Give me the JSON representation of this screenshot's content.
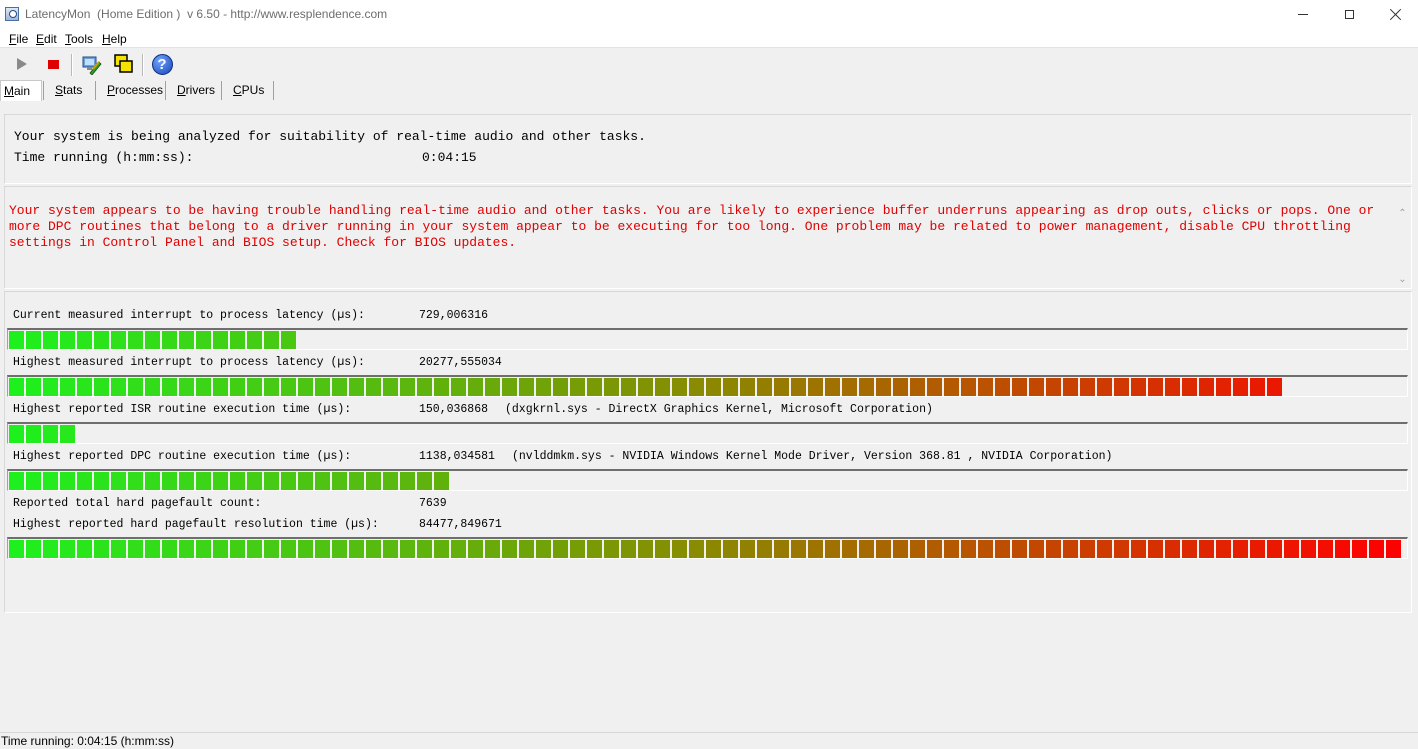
{
  "window": {
    "title": "LatencyMon  (Home Edition )  v 6.50 - http://www.resplendence.com"
  },
  "menu": [
    {
      "key": "F",
      "rest": "ile"
    },
    {
      "key": "E",
      "rest": "dit"
    },
    {
      "key": "T",
      "rest": "ools"
    },
    {
      "key": "H",
      "rest": "elp"
    }
  ],
  "toolbar": {
    "icons": [
      "play-icon",
      "stop-icon",
      "cleanup-icon",
      "windows-icon",
      "help-icon"
    ],
    "help_glyph": "?"
  },
  "tabs": [
    {
      "key": "M",
      "rest": "ain",
      "active": true
    },
    {
      "key": "S",
      "rest": "tats",
      "active": false
    },
    {
      "key": "P",
      "rest": "rocesses",
      "active": false
    },
    {
      "key": "D",
      "rest": "rivers",
      "active": false
    },
    {
      "key": "C",
      "rest": "PUs",
      "active": false
    }
  ],
  "summary": {
    "analyzing_text": "Your system is being analyzed for suitability of real-time audio and other tasks.",
    "time_label": "Time running (h:mm:ss):",
    "time_value": "0:04:15"
  },
  "warning": {
    "text": "Your system appears to be having trouble handling real-time audio and other tasks. You are likely to experience buffer underruns appearing as drop outs, clicks or pops. One or more DPC routines that belong to a driver running in your system appear to be executing for too long. One problem may be related to power management, disable CPU throttling settings in Control Panel and BIOS setup. Check for BIOS updates.",
    "color": "#e00000"
  },
  "metrics": [
    {
      "label": "Current measured interrupt to process latency (µs):",
      "value": "729,006316",
      "extra": "",
      "fill_fraction": 0.204
    },
    {
      "label": "Highest measured interrupt to process latency (µs):",
      "value": "20277,555034",
      "extra": "",
      "fill_fraction": 0.909
    },
    {
      "label": "Highest reported ISR routine execution time (µs):",
      "value": "150,036868",
      "extra": "(dxgkrnl.sys - DirectX Graphics Kernel, Microsoft Corporation)",
      "fill_fraction": 0.047
    },
    {
      "label": "Highest reported DPC routine execution time (µs):",
      "value": "1138,034581",
      "extra": "(nvlddmkm.sys - NVIDIA Windows Kernel Mode Driver, Version 368.81 , NVIDIA Corporation)",
      "fill_fraction": 0.313
    },
    {
      "label": "Reported total hard pagefault count:",
      "value": "7639",
      "extra": "",
      "fill_fraction": null
    },
    {
      "label": "Highest reported hard pagefault resolution time (µs):",
      "value": "84477,849671",
      "extra": "",
      "fill_fraction": 1.0
    }
  ],
  "bar_colors": {
    "low": "#1ef01e",
    "mid": "#8a8a00",
    "high": "#ff0000"
  },
  "statusbar": {
    "text": "Time running: 0:04:15  (h:mm:ss)"
  }
}
